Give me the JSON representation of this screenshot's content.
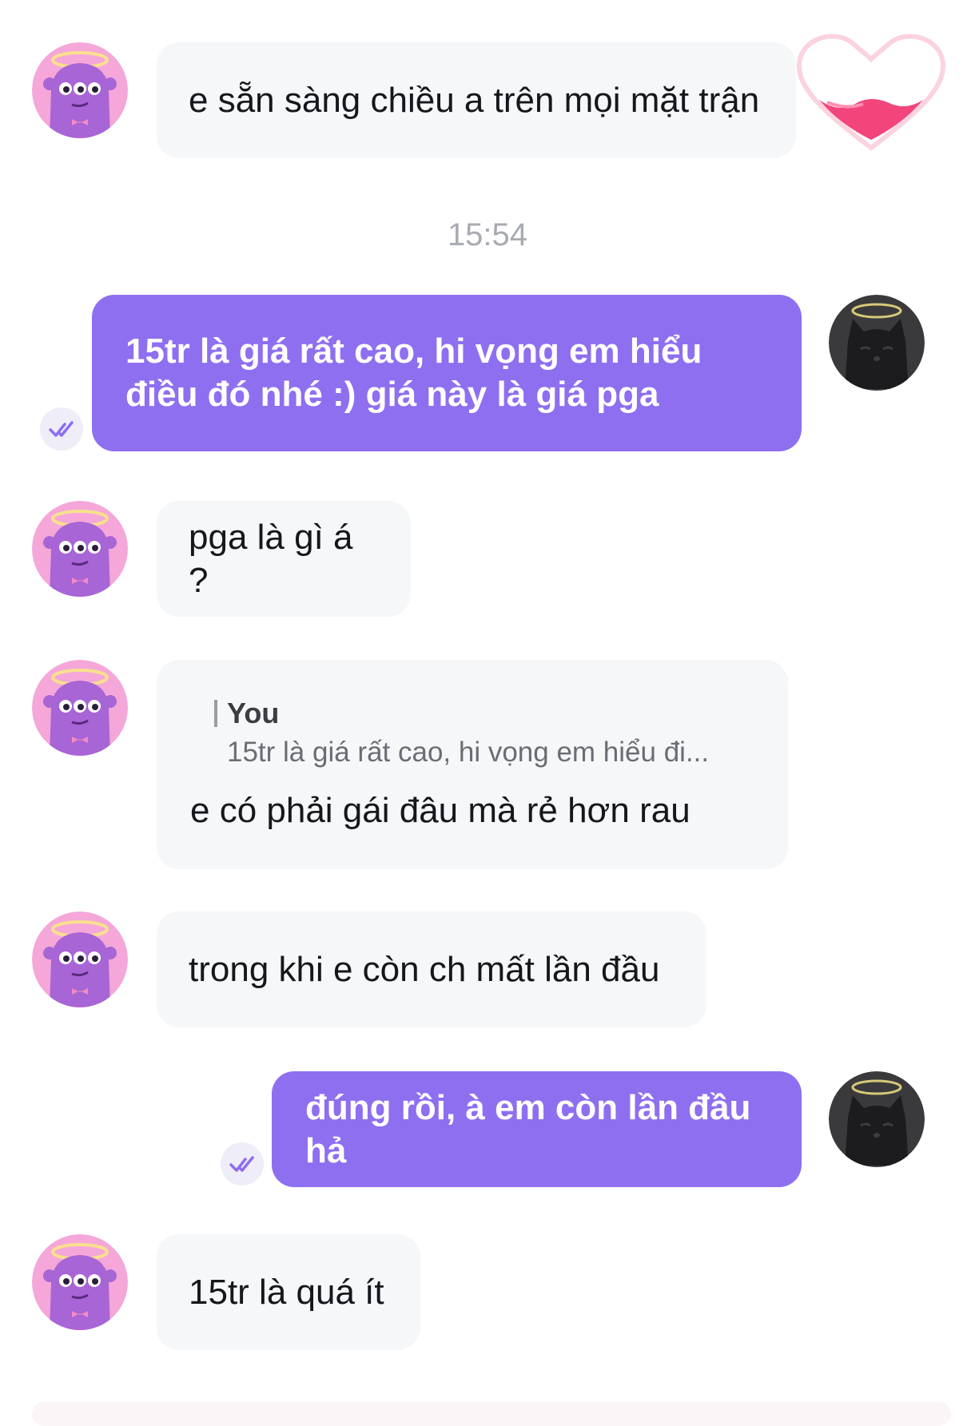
{
  "messages": [
    {
      "text": "e sẵn sàng chiều a trên mọi mặt trận"
    },
    {
      "text": "15tr là giá rất cao, hi vọng em hiểu điều đó nhé :) giá này là giá pga"
    },
    {
      "text": "pga là gì á ?"
    },
    {
      "reply_author": "You",
      "reply_quote": "15tr là giá rất cao, hi vọng em hiểu đi...",
      "text": "e có phải gái đâu mà rẻ hơn rau"
    },
    {
      "text": "trong khi e còn ch mất lần đầu"
    },
    {
      "text": "đúng rồi, à em còn lần đầu hả"
    },
    {
      "text": "15tr là quá ít"
    }
  ],
  "timestamp": "15:54",
  "colors": {
    "outgoing_bubble": "#8e6ff0",
    "incoming_bubble": "#f6f7f9",
    "timestamp": "#a8abb1",
    "read_tick": "#8e6ff0"
  },
  "icons": {
    "incoming_avatar": "purple-monster-avatar-icon",
    "outgoing_avatar": "black-cat-avatar-icon",
    "read_receipt": "double-check-icon",
    "sticker": "heart-sticker-icon"
  }
}
